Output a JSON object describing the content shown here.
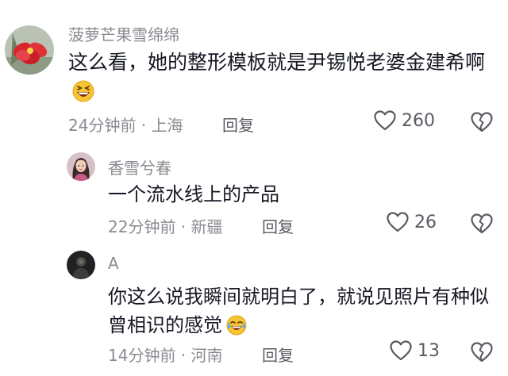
{
  "comments": [
    {
      "username": "菠萝芒果雪绵绵",
      "text": "这么看，她的整形模板就是尹锡悦老婆金建希啊",
      "emoji": "laughing-face-emoji",
      "time_location": "24分钟前 · 上海",
      "reply_label": "回复",
      "like_count": "260",
      "avatar": "red-flower-avatar"
    },
    {
      "username": "香雪兮春",
      "text": "一个流水线上的产品",
      "time_location": "22分钟前 · 新疆",
      "reply_label": "回复",
      "like_count": "26",
      "avatar": "woman-portrait-avatar"
    },
    {
      "username": "A",
      "text": "你这么说我瞬间就明白了，就说见照片有种似曾相识的感觉",
      "emoji": "sweat-smile-emoji",
      "time_location": "14分钟前 · 河南",
      "reply_label": "回复",
      "like_count": "13",
      "avatar": "dark-figure-avatar"
    }
  ],
  "icons": {
    "like": "heart-outline-icon",
    "dislike": "broken-heart-icon"
  },
  "colors": {
    "background": "#ffffff",
    "primary_text": "#161823",
    "secondary_text": "#8a8b91"
  }
}
